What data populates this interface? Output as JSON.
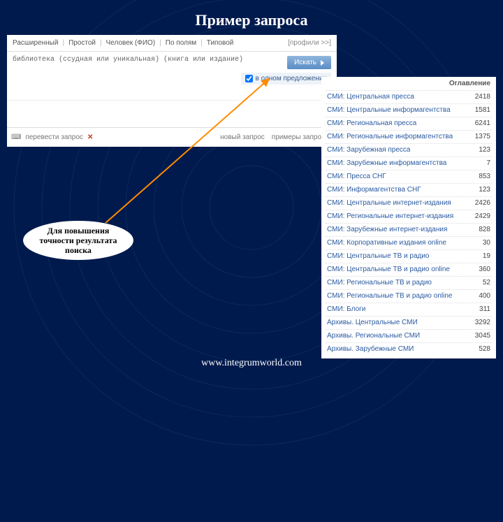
{
  "title": "Пример запроса",
  "search": {
    "tabs": {
      "expanded": "Расширенный",
      "simple": "Простой",
      "fio": "Человек (ФИО)",
      "fields": "По полям",
      "typical": "Типовой",
      "profiles": "[профили >>]"
    },
    "query_text": "библиотека (ссудная или уникальная) (книга или издание)",
    "search_button": "Искать",
    "one_sentence_label": "в одном предложении",
    "footer": {
      "translate": "перевести запрос",
      "x": "✕",
      "new_query": "новый запрос",
      "examples": "примеры запросов"
    }
  },
  "sidebar": {
    "header": "Оглавление",
    "rows": [
      {
        "label": "СМИ: Центральная пресса",
        "count": "2418"
      },
      {
        "label": "СМИ: Центральные информагентства",
        "count": "1581"
      },
      {
        "label": "СМИ: Региональная пресса",
        "count": "6241"
      },
      {
        "label": "СМИ: Региональные информагентства",
        "count": "1375"
      },
      {
        "label": "СМИ: Зарубежная пресса",
        "count": "123"
      },
      {
        "label": "СМИ: Зарубежные информагентства",
        "count": "7"
      },
      {
        "label": "СМИ: Пресса СНГ",
        "count": "853"
      },
      {
        "label": "СМИ: Информагентства СНГ",
        "count": "123"
      },
      {
        "label": "СМИ: Центральные интернет-издания",
        "count": "2426"
      },
      {
        "label": "СМИ: Региональные интернет-издания",
        "count": "2429"
      },
      {
        "label": "СМИ: Зарубежные интернет-издания",
        "count": "828"
      },
      {
        "label": "СМИ: Корпоративные издания online",
        "count": "30"
      },
      {
        "label": "СМИ: Центральные ТВ и радио",
        "count": "19"
      },
      {
        "label": "СМИ: Центральные ТВ и радио online",
        "count": "360"
      },
      {
        "label": "СМИ: Региональные ТВ и радио",
        "count": "52"
      },
      {
        "label": "СМИ: Региональные ТВ и радио online",
        "count": "400"
      },
      {
        "label": "СМИ: Блоги",
        "count": "311"
      },
      {
        "label": "Архивы. Центральные СМИ",
        "count": "3292"
      },
      {
        "label": "Архивы. Региональные СМИ",
        "count": "3045"
      },
      {
        "label": "Архивы. Зарубежные СМИ",
        "count": "528"
      }
    ]
  },
  "callout_text": "Для повышения точности результата поиска",
  "footer_url": "www.integrumworld.com"
}
